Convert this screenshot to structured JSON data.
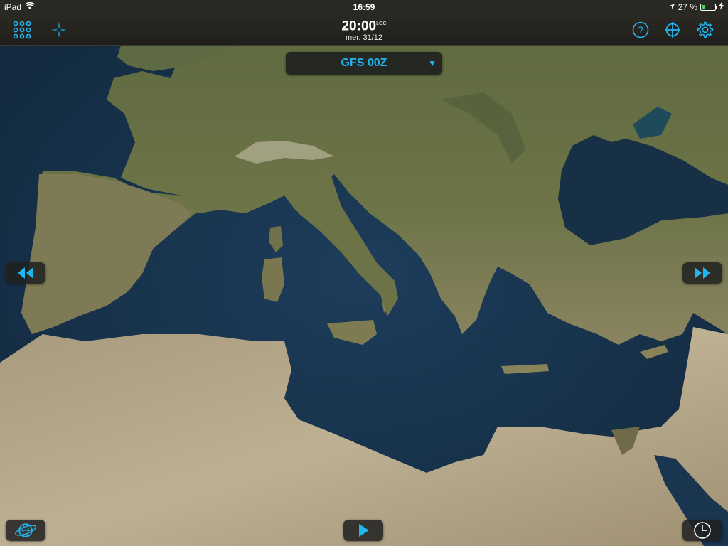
{
  "status_bar": {
    "device": "iPad",
    "clock": "16:59",
    "battery_text": "27 %",
    "battery_level": 0.27
  },
  "toolbar": {
    "time": "20:00",
    "time_suffix": "LOC",
    "date": "mer. 31/12",
    "left_icons": [
      "grid-icon",
      "compass-star-icon"
    ],
    "right_icons": [
      "help-icon",
      "crosshair-icon",
      "gear-icon"
    ]
  },
  "model_selector": {
    "value": "GFS 00Z"
  },
  "controls": {
    "previous": "rewind-icon",
    "next": "fast-forward-icon",
    "play": "play-icon",
    "globe": "globe-icon",
    "clock": "clock-icon"
  },
  "colors": {
    "accent": "#22b5f0",
    "bar_bg": "#2a2822",
    "sea": "#1c3550",
    "land": "#5e6b43",
    "desert": "#b3a68b"
  }
}
